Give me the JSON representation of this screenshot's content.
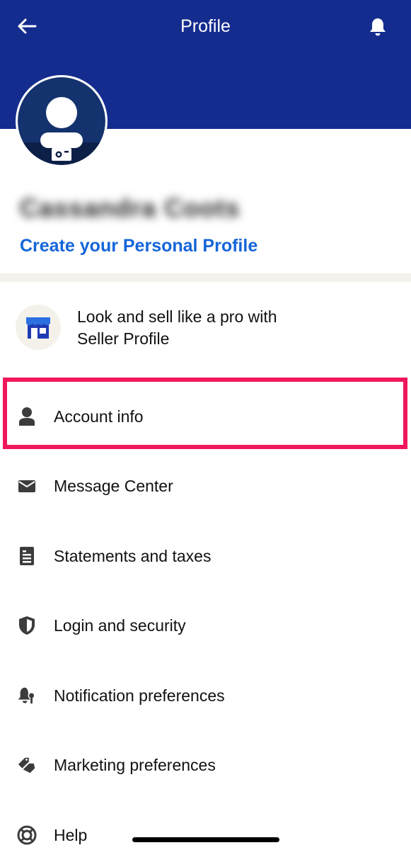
{
  "header": {
    "title": "Profile",
    "back_icon": "arrow-left-icon",
    "bell_icon": "bell-icon",
    "background_color": "#142c8e"
  },
  "profile": {
    "name": "Cassandra Coots",
    "name_obscured": true,
    "create_link": "Create your Personal Profile",
    "avatar_icon": "avatar-icon",
    "camera_icon": "camera-icon",
    "link_color": "#1565d8"
  },
  "seller": {
    "line1": "Look and sell like a pro with",
    "line2": "Seller Profile",
    "icon": "storefront-icon"
  },
  "menu": {
    "items": [
      {
        "label": "Account info",
        "icon": "person-icon",
        "highlighted": true
      },
      {
        "label": "Message Center",
        "icon": "envelope-icon"
      },
      {
        "label": "Statements and taxes",
        "icon": "document-icon"
      },
      {
        "label": "Login and security",
        "icon": "shield-icon"
      },
      {
        "label": "Notification preferences",
        "icon": "bell-gear-icon"
      },
      {
        "label": "Marketing preferences",
        "icon": "tags-icon"
      },
      {
        "label": "Help",
        "icon": "lifebuoy-icon"
      }
    ]
  },
  "highlight_color": "#f0175a"
}
